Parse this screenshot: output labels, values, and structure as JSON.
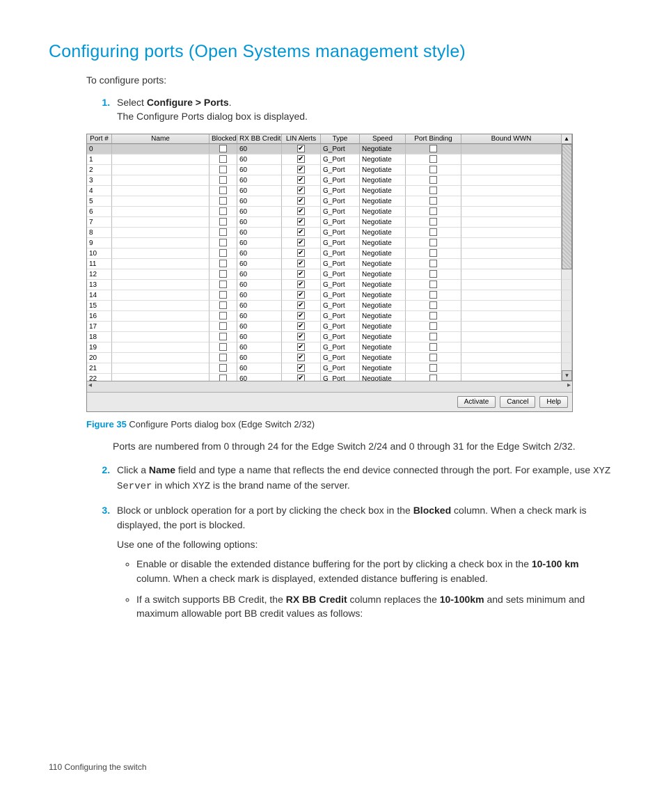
{
  "title": "Configuring ports (Open Systems management style)",
  "intro": "To configure ports:",
  "step1_a": "Select ",
  "step1_b": "Configure > Ports",
  "step1_c": ".",
  "step1_sub": "The Configure Ports dialog box is displayed.",
  "cols": {
    "port": "Port #",
    "name": "Name",
    "blocked": "Blocked",
    "rx": "RX BB Credit",
    "lin": "LIN Alerts",
    "type": "Type",
    "speed": "Speed",
    "pb": "Port Binding",
    "wwn": "Bound WWN"
  },
  "rows": [
    {
      "port": "0",
      "rx": "60",
      "lin": true,
      "type": "G_Port",
      "speed": "Negotiate"
    },
    {
      "port": "1",
      "rx": "60",
      "lin": true,
      "type": "G_Port",
      "speed": "Negotiate"
    },
    {
      "port": "2",
      "rx": "60",
      "lin": true,
      "type": "G_Port",
      "speed": "Negotiate"
    },
    {
      "port": "3",
      "rx": "60",
      "lin": true,
      "type": "G_Port",
      "speed": "Negotiate"
    },
    {
      "port": "4",
      "rx": "60",
      "lin": true,
      "type": "G_Port",
      "speed": "Negotiate"
    },
    {
      "port": "5",
      "rx": "60",
      "lin": true,
      "type": "G_Port",
      "speed": "Negotiate"
    },
    {
      "port": "6",
      "rx": "60",
      "lin": true,
      "type": "G_Port",
      "speed": "Negotiate"
    },
    {
      "port": "7",
      "rx": "60",
      "lin": true,
      "type": "G_Port",
      "speed": "Negotiate"
    },
    {
      "port": "8",
      "rx": "60",
      "lin": true,
      "type": "G_Port",
      "speed": "Negotiate"
    },
    {
      "port": "9",
      "rx": "60",
      "lin": true,
      "type": "G_Port",
      "speed": "Negotiate"
    },
    {
      "port": "10",
      "rx": "60",
      "lin": true,
      "type": "G_Port",
      "speed": "Negotiate"
    },
    {
      "port": "11",
      "rx": "60",
      "lin": true,
      "type": "G_Port",
      "speed": "Negotiate"
    },
    {
      "port": "12",
      "rx": "60",
      "lin": true,
      "type": "G_Port",
      "speed": "Negotiate"
    },
    {
      "port": "13",
      "rx": "60",
      "lin": true,
      "type": "G_Port",
      "speed": "Negotiate"
    },
    {
      "port": "14",
      "rx": "60",
      "lin": true,
      "type": "G_Port",
      "speed": "Negotiate"
    },
    {
      "port": "15",
      "rx": "60",
      "lin": true,
      "type": "G_Port",
      "speed": "Negotiate"
    },
    {
      "port": "16",
      "rx": "60",
      "lin": true,
      "type": "G_Port",
      "speed": "Negotiate"
    },
    {
      "port": "17",
      "rx": "60",
      "lin": true,
      "type": "G_Port",
      "speed": "Negotiate"
    },
    {
      "port": "18",
      "rx": "60",
      "lin": true,
      "type": "G_Port",
      "speed": "Negotiate"
    },
    {
      "port": "19",
      "rx": "60",
      "lin": true,
      "type": "G_Port",
      "speed": "Negotiate"
    },
    {
      "port": "20",
      "rx": "60",
      "lin": true,
      "type": "G_Port",
      "speed": "Negotiate"
    },
    {
      "port": "21",
      "rx": "60",
      "lin": true,
      "type": "G_Port",
      "speed": "Negotiate"
    },
    {
      "port": "22",
      "rx": "60",
      "lin": true,
      "type": "G_Port",
      "speed": "Negotiate"
    }
  ],
  "buttons": {
    "activate": "Activate",
    "cancel": "Cancel",
    "help": "Help"
  },
  "caption_label": "Figure 35",
  "caption_text": " Configure Ports dialog box (Edge Switch 2/32)",
  "after_fig": "Ports are numbered from 0 through 24 for the Edge Switch 2/24 and 0 through 31 for the Edge Switch 2/32.",
  "step2_a": "Click a ",
  "step2_b": "Name",
  "step2_c": " field and type a name that reflects the end device connected through the port. For example, use ",
  "step2_code1": "XYZ Server",
  "step2_d": " in which ",
  "step2_code2": "XYZ",
  "step2_e": " is the brand name of the server.",
  "step3_a": "Block or unblock operation for a port by clicking the check box in the ",
  "step3_b": "Blocked",
  "step3_c": " column. When a check mark is displayed, the port is blocked.",
  "step3_sub": "Use one of the following options:",
  "opt1_a": "Enable or disable the extended distance buffering for the port by clicking a check box in the ",
  "opt1_b": "10-100 km",
  "opt1_c": " column. When a check mark is displayed, extended distance buffering is enabled.",
  "opt2_a": "If a switch supports BB Credit, the ",
  "opt2_b": "RX BB Credit",
  "opt2_c": " column replaces the ",
  "opt2_d": "10-100km",
  "opt2_e": " and sets minimum and maximum allowable port BB credit values as follows:",
  "footer": "110   Configuring the switch",
  "vsb_down": "▾"
}
